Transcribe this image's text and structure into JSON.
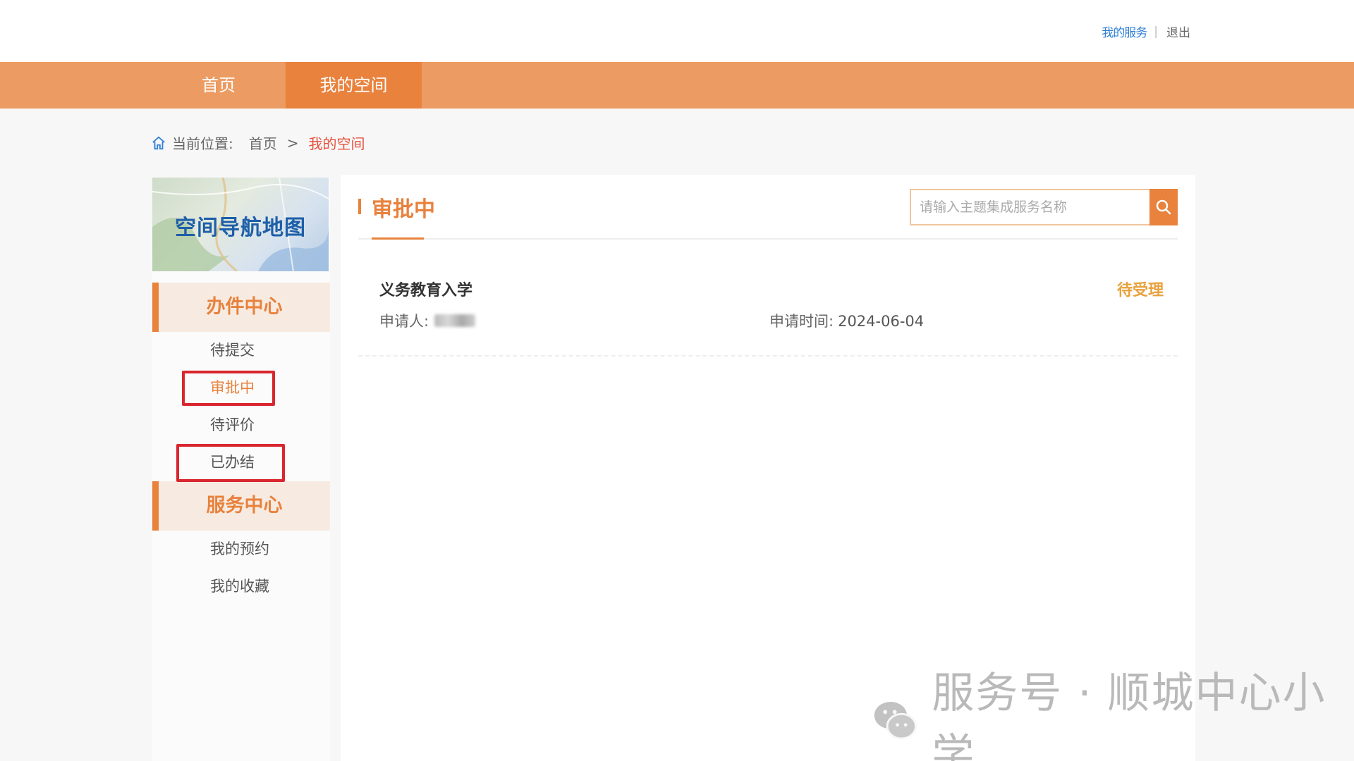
{
  "top": {
    "user_label": "我的服务",
    "logout_label": "退出"
  },
  "nav": {
    "home_label": "首页",
    "space_label": "我的空间"
  },
  "breadcrumb": {
    "location_label": "当前位置:",
    "home": "首页",
    "arrow": ">",
    "current": "我的空间"
  },
  "sidebar": {
    "map_title": "空间导航地图",
    "office_center": "办件中心",
    "office_items": [
      {
        "label": "待提交"
      },
      {
        "label": "审批中"
      },
      {
        "label": "待评价"
      },
      {
        "label": "已办结"
      }
    ],
    "service_center": "服务中心",
    "service_items": [
      {
        "label": "我的预约"
      },
      {
        "label": "我的收藏"
      }
    ]
  },
  "main": {
    "title": "审批中",
    "search_placeholder": "请输入主题集成服务名称",
    "record": {
      "title": "义务教育入学",
      "status": "待受理",
      "applicant_label": "申请人:",
      "time_label": "申请时间:",
      "time_value": "2024-06-04"
    }
  },
  "watermark": {
    "text": "服务号 · 顺城中心小学"
  },
  "colors": {
    "nav_bg": "#ec9b62",
    "nav_active": "#e8823d",
    "accent": "#e8823d",
    "highlight_box": "#d9262f"
  }
}
